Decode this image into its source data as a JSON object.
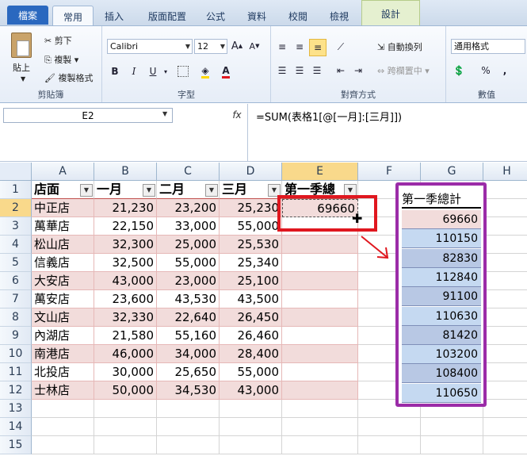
{
  "tabs": [
    "檔案",
    "常用",
    "插入",
    "版面配置",
    "公式",
    "資料",
    "校閱",
    "檢視",
    "設計"
  ],
  "ribbon": {
    "clipboard": {
      "paste": "貼上",
      "cut": "剪下",
      "copy": "複製",
      "format_painter": "複製格式",
      "label": "剪貼簿"
    },
    "font": {
      "name": "Calibri",
      "size": "12",
      "label": "字型"
    },
    "alignment": {
      "label": "對齊方式",
      "wrap": "自動換列",
      "merge": "跨欄置中"
    },
    "number": {
      "format": "通用格式",
      "label": "數值",
      "percent": "%",
      "comma": ","
    }
  },
  "formula_bar": {
    "name_box": "E2",
    "fx": "fx",
    "formula": "=SUM(表格1[@[一月]:[三月]])"
  },
  "columns": [
    "A",
    "B",
    "C",
    "D",
    "E",
    "F",
    "G",
    "H"
  ],
  "rows": [
    "1",
    "2",
    "3",
    "4",
    "5",
    "6",
    "7",
    "8",
    "9",
    "10",
    "11",
    "12",
    "13",
    "14",
    "15"
  ],
  "table": {
    "headers": [
      "店面",
      "一月",
      "二月",
      "三月",
      "第一季總"
    ],
    "data": [
      [
        "中正店",
        "21,230",
        "23,200",
        "25,230"
      ],
      [
        "萬華店",
        "22,150",
        "33,000",
        "55,000"
      ],
      [
        "松山店",
        "32,300",
        "25,000",
        "25,530"
      ],
      [
        "信義店",
        "32,500",
        "55,000",
        "25,340"
      ],
      [
        "大安店",
        "43,000",
        "23,000",
        "25,100"
      ],
      [
        "萬安店",
        "23,600",
        "43,530",
        "43,500"
      ],
      [
        "文山店",
        "32,330",
        "22,640",
        "26,450"
      ],
      [
        "內湖店",
        "21,580",
        "55,160",
        "26,460"
      ],
      [
        "南港店",
        "46,000",
        "34,000",
        "28,400"
      ],
      [
        "北投店",
        "30,000",
        "25,650",
        "55,000"
      ],
      [
        "士林店",
        "50,000",
        "34,530",
        "43,000"
      ]
    ],
    "e2_value": "69660"
  },
  "result": {
    "header": "第一季總計",
    "values": [
      "69660",
      "110150",
      "82830",
      "112840",
      "91100",
      "110630",
      "81420",
      "103200",
      "108400",
      "110650"
    ]
  },
  "colors": {
    "highlight_red": "#e0171f",
    "highlight_purple": "#9b2ca8",
    "table_pink": "#f2dcdb",
    "table_border": "#c0504d"
  }
}
